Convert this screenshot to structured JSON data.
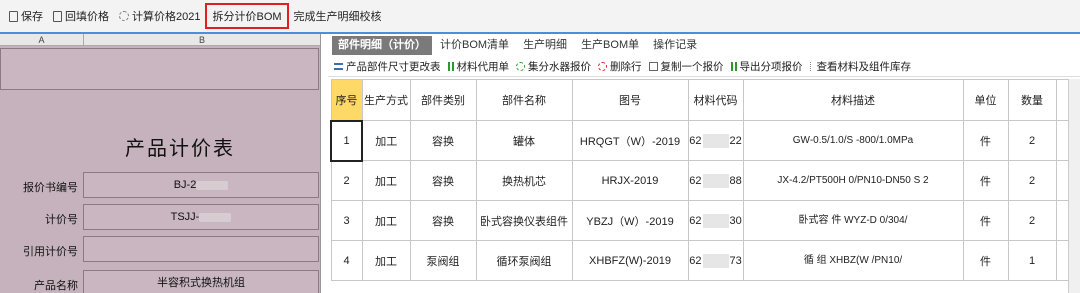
{
  "toolbar": {
    "items": [
      "保存",
      "回填价格",
      "计算价格2021",
      "拆分计价BOM",
      "完成生产明细校核"
    ]
  },
  "sheet": {
    "col_a": "A",
    "col_b": "B",
    "title": "产品计价表",
    "rows": [
      {
        "label": "报价书编号",
        "value": "BJ-2"
      },
      {
        "label": "计价号",
        "value": "TSJJ-"
      },
      {
        "label": "引用计价号",
        "value": ""
      },
      {
        "label": "产品名称",
        "value": "半容积式换热机组"
      }
    ]
  },
  "tabs": [
    "部件明细（计价）",
    "计价BOM清单",
    "生产明细",
    "生产BOM单",
    "操作记录"
  ],
  "subtools": [
    "产品部件尺寸更改表",
    "材料代用单",
    "集分水器报价",
    "删除行",
    "复制一个报价",
    "导出分项报价",
    "查看材料及组件库存"
  ],
  "grid": {
    "headers": [
      "序号",
      "生产方式",
      "部件类别",
      "部件名称",
      "图号",
      "材料代码",
      "材料描述",
      "单位",
      "数量"
    ],
    "rows": [
      {
        "seq": "1",
        "mode": "加工",
        "cat": "容换",
        "name": "罐体",
        "drawing": "HRQGT（W）-2019",
        "code_a": "62",
        "code_b": "22",
        "desc": "GW-0.5/1.0/S -800/1.0MPa",
        "unit": "件",
        "qty": "2"
      },
      {
        "seq": "2",
        "mode": "加工",
        "cat": "容换",
        "name": "换热机芯",
        "drawing": "HRJX-2019",
        "code_a": "62",
        "code_b": "88",
        "desc": "JX-4.2/PT500H 0/PN10-DN50 S 2",
        "unit": "件",
        "qty": "2"
      },
      {
        "seq": "3",
        "mode": "加工",
        "cat": "容换",
        "name": "卧式容换仪表组件",
        "drawing": "YBZJ（W）-2019",
        "code_a": "62",
        "code_b": "30",
        "desc": "卧式容 件 WYZ-D 0/304/",
        "unit": "件",
        "qty": "2"
      },
      {
        "seq": "4",
        "mode": "加工",
        "cat": "泵阀组",
        "name": "循环泵阀组",
        "drawing": "XHBFZ(W)-2019",
        "code_a": "62",
        "code_b": "73",
        "desc": "循 组 XHBZ(W /PN10/",
        "unit": "件",
        "qty": "1"
      }
    ]
  }
}
